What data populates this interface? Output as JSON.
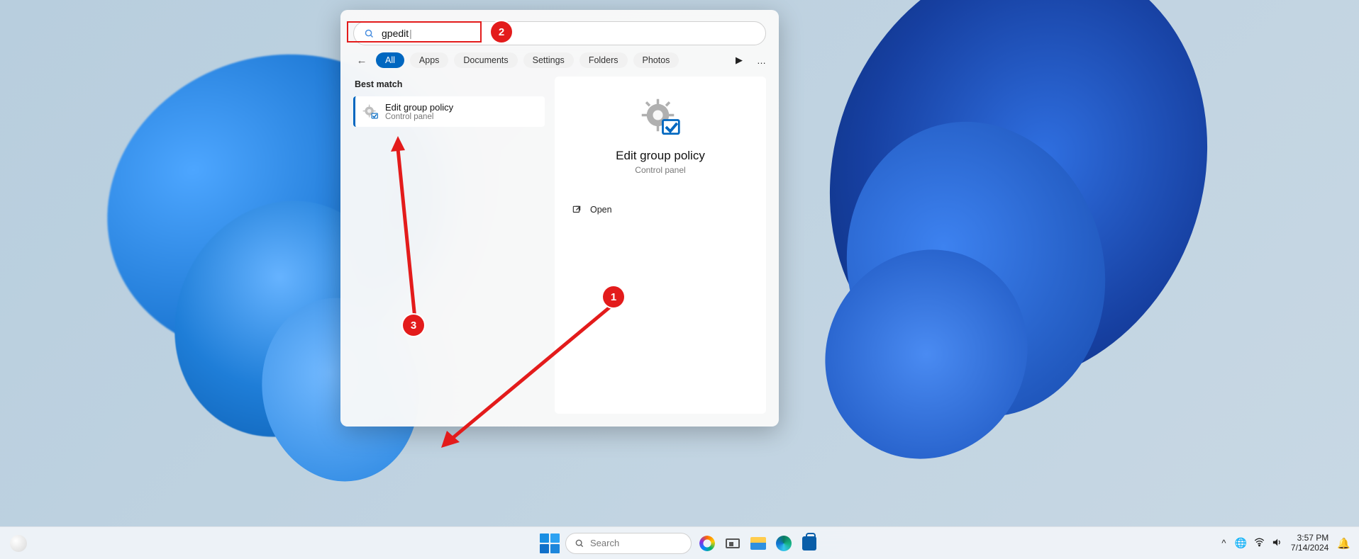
{
  "search": {
    "query": "gpedit",
    "placeholder": "Search"
  },
  "filters": {
    "all": "All",
    "apps": "Apps",
    "documents": "Documents",
    "settings": "Settings",
    "folders": "Folders",
    "photos": "Photos"
  },
  "results": {
    "section_label": "Best match",
    "item": {
      "title": "Edit group policy",
      "subtitle": "Control panel"
    }
  },
  "detail": {
    "title": "Edit group policy",
    "subtitle": "Control panel",
    "actions": {
      "open": "Open"
    }
  },
  "taskbar": {
    "search_placeholder": "Search"
  },
  "tray": {
    "time": "3:57 PM",
    "date": "7/14/2024"
  },
  "annotations": {
    "n1": "1",
    "n2": "2",
    "n3": "3"
  }
}
